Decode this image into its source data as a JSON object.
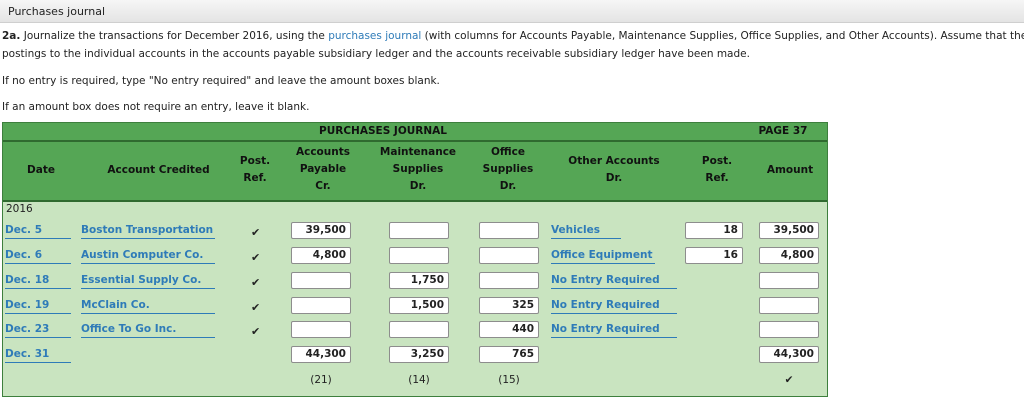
{
  "tab": {
    "title": "Purchases journal"
  },
  "instructions": {
    "label": "2a.",
    "line1_a": " Journalize the transactions for December 2016, using the ",
    "line1_link": "purchases journal",
    "line1_b": " (with columns for Accounts Payable, Maintenance Supplies, Office Supplies, and Other Accounts). Assume that the daily",
    "line2": "postings to the individual accounts in the accounts payable subsidiary ledger and the accounts receivable subsidiary ledger have been made.",
    "line3": "If no entry is required, type \"No entry required\" and leave the amount boxes blank.",
    "line4": "If an amount box does not require an entry, leave it blank."
  },
  "journal": {
    "title": "PURCHASES JOURNAL",
    "page": "PAGE 37",
    "headers": {
      "date": "Date",
      "account": "Account Credited",
      "post_ref": [
        "Post.",
        "Ref."
      ],
      "ap": [
        "Accounts",
        "Payable",
        "Cr."
      ],
      "maint": [
        "Maintenance",
        "Supplies",
        "Dr."
      ],
      "office": [
        "Office",
        "Supplies",
        "Dr."
      ],
      "other": [
        "Other Accounts",
        "Dr."
      ],
      "post_ref2": [
        "Post.",
        "Ref."
      ],
      "amount": "Amount"
    },
    "year": "2016",
    "rows": [
      {
        "date": "Dec. 5",
        "account": "Boston Transportation",
        "check": "✔",
        "ap": "39,500",
        "maint": "",
        "office": "",
        "other": "Vehicles",
        "ref": "18",
        "amount": "39,500"
      },
      {
        "date": "Dec. 6",
        "account": "Austin Computer Co.",
        "check": "✔",
        "ap": "4,800",
        "maint": "",
        "office": "",
        "other": "Office Equipment",
        "ref": "16",
        "amount": "4,800"
      },
      {
        "date": "Dec. 18",
        "account": "Essential Supply Co.",
        "check": "✔",
        "ap": "",
        "maint": "1,750",
        "office": "",
        "other": "No Entry Required",
        "ref": "",
        "amount": ""
      },
      {
        "date": "Dec. 19",
        "account": "McClain Co.",
        "check": "✔",
        "ap": "",
        "maint": "1,500",
        "office": "325",
        "other": "No Entry Required",
        "ref": "",
        "amount": ""
      },
      {
        "date": "Dec. 23",
        "account": "Office To Go Inc.",
        "check": "✔",
        "ap": "",
        "maint": "",
        "office": "440",
        "other": "No Entry Required",
        "ref": "",
        "amount": ""
      }
    ],
    "totals": {
      "date": "Dec. 31",
      "ap": "44,300",
      "maint": "3,250",
      "office": "765",
      "amount": "44,300"
    },
    "posting": {
      "ap": "(21)",
      "maint": "(14)",
      "office": "(15)",
      "amount": "✔"
    }
  }
}
